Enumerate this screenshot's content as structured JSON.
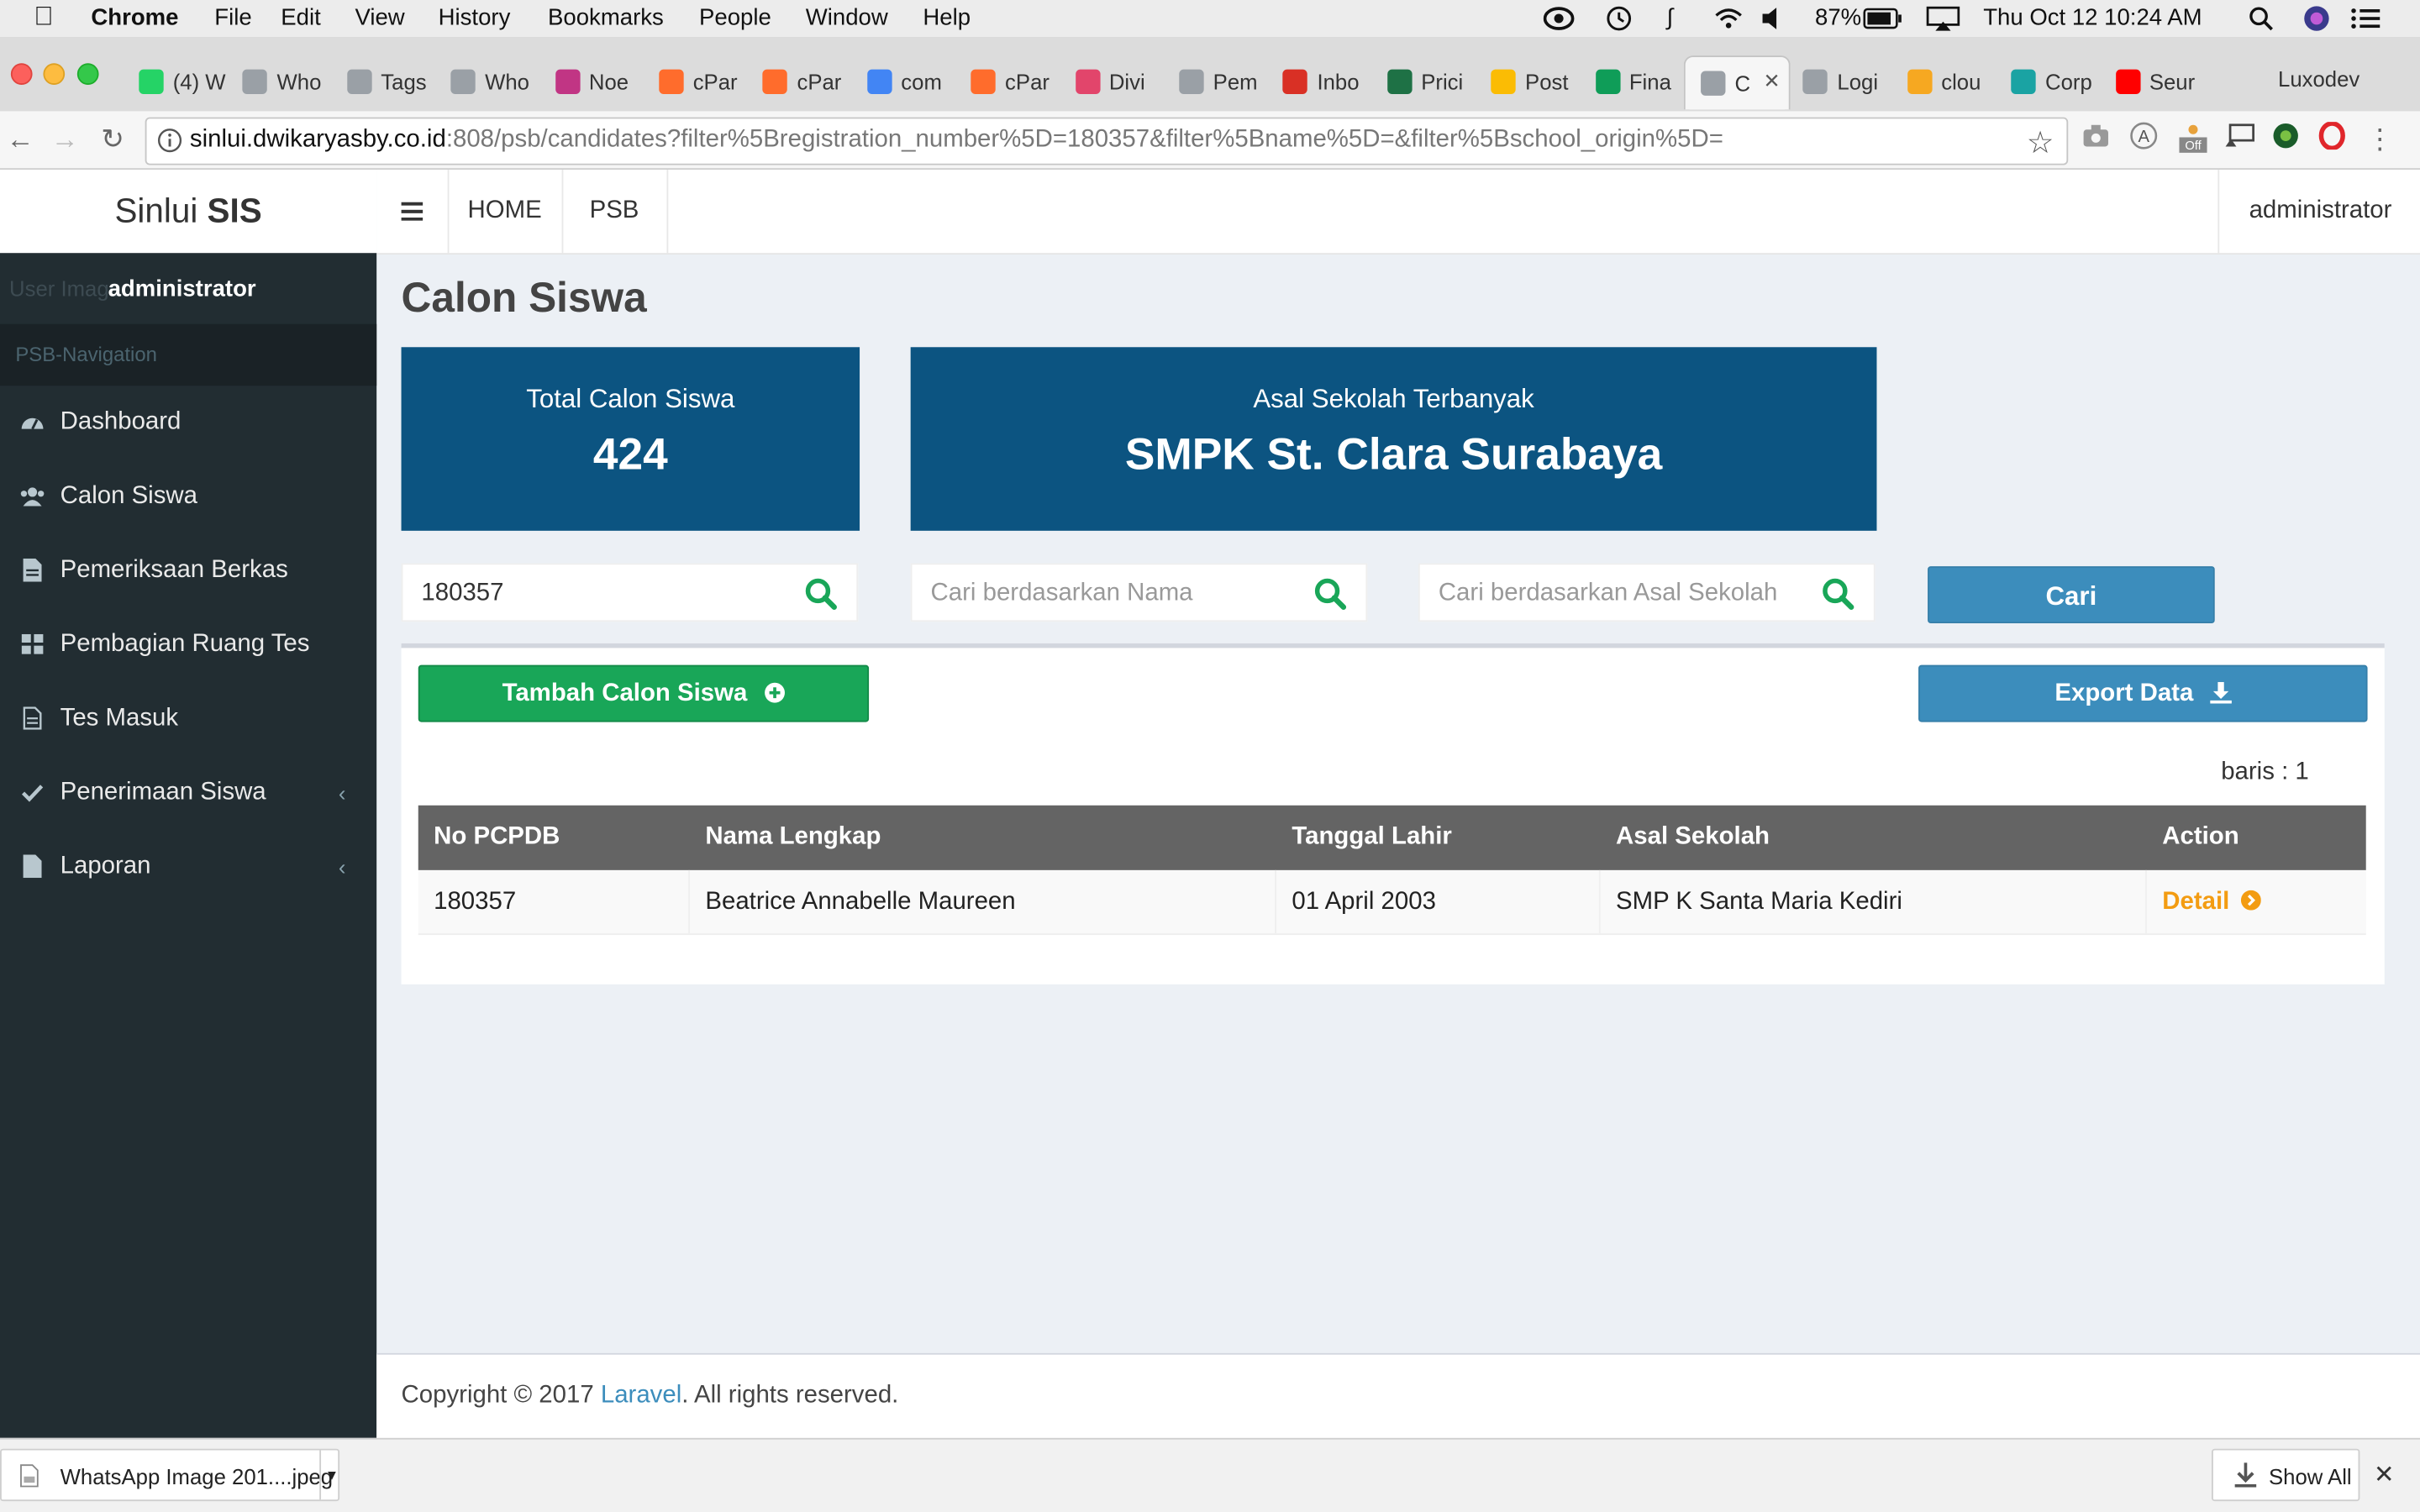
{
  "menubar": {
    "app": "Chrome",
    "items": [
      "File",
      "Edit",
      "View",
      "History",
      "Bookmarks",
      "People",
      "Window",
      "Help"
    ],
    "battery": "87%",
    "datetime": "Thu Oct 12  10:24 AM"
  },
  "tabs": [
    {
      "label": "(4) W",
      "color": "#25d366"
    },
    {
      "label": "Who",
      "color": "#9aa0a6"
    },
    {
      "label": "Tags",
      "color": "#9aa0a6"
    },
    {
      "label": "Who",
      "color": "#9aa0a6"
    },
    {
      "label": "Noe",
      "color": "#c13584"
    },
    {
      "label": "cPar",
      "color": "#ff6c2c"
    },
    {
      "label": "cPar",
      "color": "#ff6c2c"
    },
    {
      "label": "com",
      "color": "#4285f4"
    },
    {
      "label": "cPar",
      "color": "#ff6c2c"
    },
    {
      "label": "Divi",
      "color": "#e2456b"
    },
    {
      "label": "Pem",
      "color": "#9aa0a6"
    },
    {
      "label": "Inbo",
      "color": "#d93025"
    },
    {
      "label": "Prici",
      "color": "#1e7145"
    },
    {
      "label": "Post",
      "color": "#fbbc04"
    },
    {
      "label": "Fina",
      "color": "#0f9d58"
    },
    {
      "label": "C",
      "color": "#9aa0a6"
    },
    {
      "label": "Logi",
      "color": "#9aa0a6"
    },
    {
      "label": "clou",
      "color": "#f6a821"
    },
    {
      "label": "Corp",
      "color": "#1aa3a3"
    },
    {
      "label": "Seur",
      "color": "#ff0000"
    },
    {
      "label": "",
      "color": "#dcdcdc"
    }
  ],
  "profile": "Luxodev",
  "address": {
    "host": "sinlui.dwikaryasby.co.id",
    "rest": ":808/psb/candidates?filter%5Bregistration_number%5D=180357&filter%5Bname%5D=&filter%5Bschool_origin%5D="
  },
  "app": {
    "logo_light": "Sinlui ",
    "logo_bold": "SIS",
    "nav": [
      "HOME",
      "PSB"
    ],
    "user": "administrator"
  },
  "sidebar": {
    "user_image_alt": "User Image",
    "user_name": "administrator",
    "header": "PSB-Navigation",
    "items": [
      {
        "label": "Dashboard",
        "icon": "dashboard-icon"
      },
      {
        "label": "Calon Siswa",
        "icon": "users-icon"
      },
      {
        "label": "Pemeriksaan Berkas",
        "icon": "file-text-icon"
      },
      {
        "label": "Pembagian Ruang Tes",
        "icon": "grid-icon"
      },
      {
        "label": "Tes Masuk",
        "icon": "file-text-icon"
      },
      {
        "label": "Penerimaan Siswa",
        "icon": "check-icon"
      },
      {
        "label": "Laporan",
        "icon": "file-icon"
      }
    ]
  },
  "page": {
    "title": "Calon Siswa",
    "stats": {
      "total_label": "Total Calon Siswa",
      "total_value": "424",
      "school_label": "Asal Sekolah Terbanyak",
      "school_value": "SMPK St. Clara Surabaya"
    },
    "filters": {
      "registration_value": "180357",
      "name_placeholder": "Cari berdasarkan Nama",
      "school_placeholder": "Cari berdasarkan Asal Sekolah",
      "search_button": "Cari"
    },
    "add_button": "Tambah Calon Siswa",
    "export_button": "Export Data",
    "row_count": "baris : 1",
    "table": {
      "headers": [
        "No PCPDB",
        "Nama Lengkap",
        "Tanggal Lahir",
        "Asal Sekolah",
        "Action"
      ],
      "rows": [
        [
          "180357",
          "Beatrice Annabelle Maureen",
          "01 April 2003",
          "SMP K Santa Maria Kediri",
          "Detail"
        ]
      ]
    }
  },
  "footer": {
    "prefix": "Copyright © 2017 ",
    "link": "Laravel",
    "suffix": ". All rights reserved."
  },
  "downloads": {
    "file": "WhatsApp Image 201....jpeg",
    "show_all": "Show All"
  },
  "colors": {
    "header_blue": "#0c5481",
    "primary": "#3c8dbc",
    "success": "#19a658",
    "sidebar": "#222d32",
    "detail_orange": "#f39c12",
    "search_icon_green": "#19a658"
  }
}
